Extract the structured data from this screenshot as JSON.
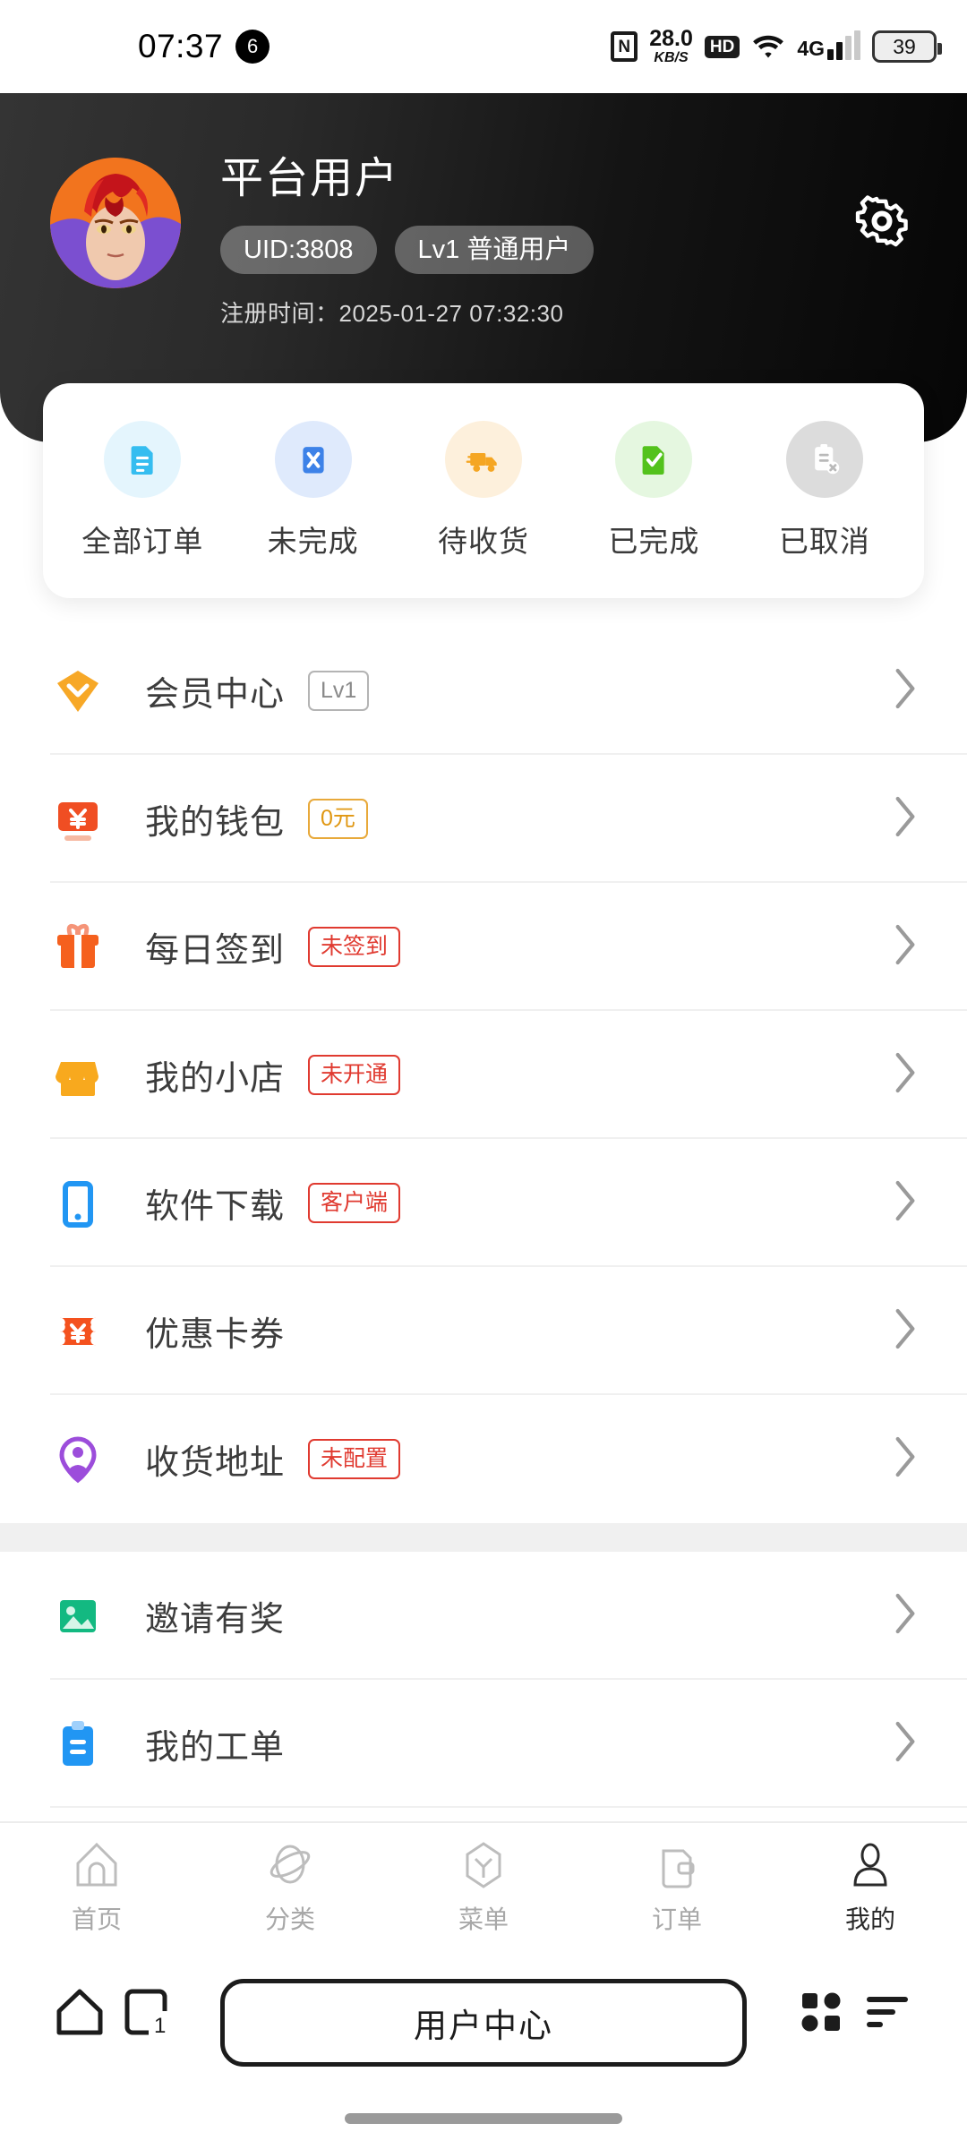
{
  "statusbar": {
    "time": "07:37",
    "notification_count": "6",
    "nfc_icon": "nfc-icon",
    "net_speed_value": "28.0",
    "net_speed_unit": "KB/S",
    "hd_label": "HD",
    "wifi_icon": "wifi-icon",
    "network_type": "4G",
    "battery_percent": "39"
  },
  "header": {
    "username": "平台用户",
    "uid_chip": "UID:3808",
    "level_chip": "Lv1 普通用户",
    "register_label": "注册时间：",
    "register_time": "2025-01-27 07:32:30",
    "settings_icon": "gear-icon",
    "avatar_icon": "avatar",
    "bg_start": "#343434",
    "bg_end": "#060606"
  },
  "order_card": {
    "items": [
      {
        "label": "全部订单",
        "icon": "document-icon",
        "color": "#35bdf0",
        "bg": "#e4f5fd"
      },
      {
        "label": "未完成",
        "icon": "cancel-doc-icon",
        "color": "#3d82e8",
        "bg": "#dfeafc"
      },
      {
        "label": "待收货",
        "icon": "truck-icon",
        "color": "#f5a623",
        "bg": "#fdf0dc"
      },
      {
        "label": "已完成",
        "icon": "check-doc-icon",
        "color": "#53c21c",
        "bg": "#e5f7e0"
      },
      {
        "label": "已取消",
        "icon": "cancel-clipboard-icon",
        "color": "#b9b9b9",
        "bg": "#dcdcdc"
      }
    ]
  },
  "menu": {
    "group1": [
      {
        "label": "会员中心",
        "icon": "diamond-icon",
        "icon_color": "#f7a827",
        "tag": "Lv1",
        "tag_style": "gray"
      },
      {
        "label": "我的钱包",
        "icon": "wallet-icon",
        "icon_color": "#f04e23",
        "tag": "0元",
        "tag_style": "amber"
      },
      {
        "label": "每日签到",
        "icon": "gift-icon",
        "icon_color": "#f5601e",
        "tag": "未签到",
        "tag_style": "red"
      },
      {
        "label": "我的小店",
        "icon": "shop-icon",
        "icon_color": "#f8a91e",
        "tag": "未开通",
        "tag_style": "red"
      },
      {
        "label": "软件下载",
        "icon": "phone-icon",
        "icon_color": "#2196f3",
        "tag": "客户端",
        "tag_style": "red"
      },
      {
        "label": "优惠卡券",
        "icon": "coupon-icon",
        "icon_color": "#f4511e",
        "tag": "",
        "tag_style": ""
      },
      {
        "label": "收货地址",
        "icon": "location-pin-icon",
        "icon_color": "#9c4ddb",
        "tag": "未配置",
        "tag_style": "red"
      }
    ],
    "group2": [
      {
        "label": "邀请有奖",
        "icon": "image-gift-icon",
        "icon_color": "#13b981",
        "tag": "",
        "tag_style": ""
      },
      {
        "label": "我的工单",
        "icon": "clipboard-icon",
        "icon_color": "#2196f3",
        "tag": "",
        "tag_style": ""
      }
    ],
    "chevron_icon": "chevron-right-icon"
  },
  "tabbar": {
    "items": [
      {
        "label": "首页",
        "icon": "home-icon",
        "active": false
      },
      {
        "label": "分类",
        "icon": "planet-icon",
        "active": false
      },
      {
        "label": "菜单",
        "icon": "menu-cube-icon",
        "active": false
      },
      {
        "label": "订单",
        "icon": "order-icon",
        "active": false
      },
      {
        "label": "我的",
        "icon": "person-icon",
        "active": true
      }
    ]
  },
  "browserbar": {
    "home_icon": "browser-home-icon",
    "tabs_icon": "browser-tabs-icon",
    "tabs_count": "1",
    "url_title": "用户中心",
    "apps_icon": "apps-grid-icon",
    "menu_icon": "hamburger-menu-icon"
  }
}
